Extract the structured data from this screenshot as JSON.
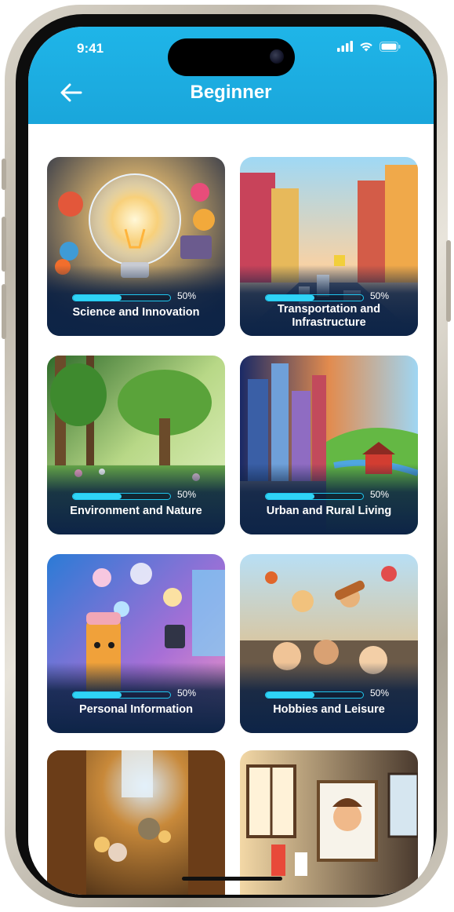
{
  "status_bar": {
    "time": "9:41"
  },
  "header": {
    "title": "Beginner"
  },
  "colors": {
    "accent": "#1fb5e8",
    "card_bg": "#0d2447",
    "progress": "#2fd3f6"
  },
  "cards": [
    {
      "title": "Science and Innovation",
      "progress_label": "50%",
      "progress": 0.5
    },
    {
      "title": "Transportation and Infrastructure",
      "progress_label": "50%",
      "progress": 0.5
    },
    {
      "title": "Environment and Nature",
      "progress_label": "50%",
      "progress": 0.5
    },
    {
      "title": "Urban and Rural Living",
      "progress_label": "50%",
      "progress": 0.5
    },
    {
      "title": "Personal Information",
      "progress_label": "50%",
      "progress": 0.5
    },
    {
      "title": "Hobbies and Leisure",
      "progress_label": "50%",
      "progress": 0.5
    },
    {
      "title": "",
      "progress_label": "",
      "progress": 0
    },
    {
      "title": "",
      "progress_label": "",
      "progress": 0
    }
  ],
  "icons": [
    "back-arrow-icon",
    "signal-icon",
    "wifi-icon",
    "battery-icon"
  ]
}
